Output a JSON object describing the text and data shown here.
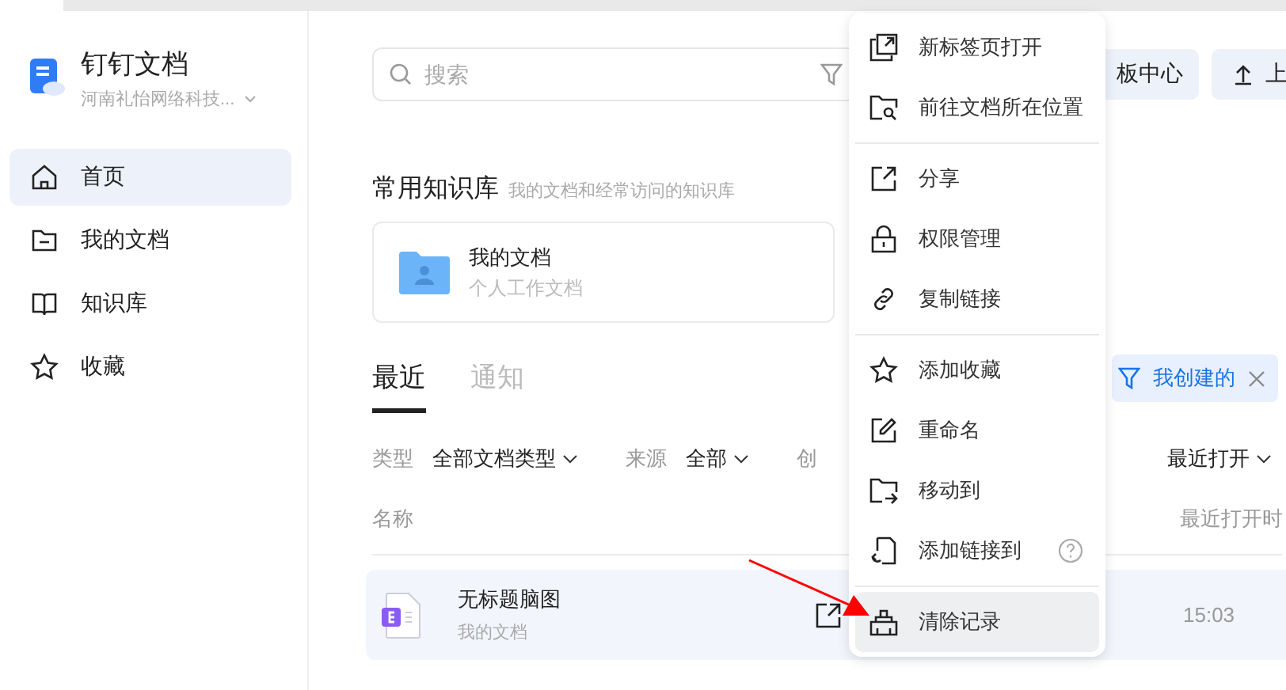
{
  "sidebar": {
    "app_title": "钉钉文档",
    "organization": "河南礼怡网络科技...",
    "items": [
      {
        "label": "首页",
        "selected": true
      },
      {
        "label": "我的文档",
        "selected": false
      },
      {
        "label": "知识库",
        "selected": false
      },
      {
        "label": "收藏",
        "selected": false
      }
    ]
  },
  "search": {
    "placeholder": "搜索"
  },
  "header_buttons": [
    "板中心",
    "上"
  ],
  "knowledge": {
    "title": "常用知识库",
    "subtitle": "我的文档和经常访问的知识库",
    "card": {
      "name": "我的文档",
      "description": "个人工作文档"
    }
  },
  "tabs": [
    {
      "label": "最近",
      "selected": true
    },
    {
      "label": "通知",
      "selected": false
    }
  ],
  "filter_chip": {
    "label": "我创建的"
  },
  "filters": [
    {
      "label": "类型",
      "value": "全部文档类型"
    },
    {
      "label": "来源",
      "value": "全部"
    },
    {
      "label": "创"
    }
  ],
  "sort": {
    "value": "最近打开"
  },
  "table": {
    "columns": [
      "名称",
      "最近打开时"
    ],
    "rows": [
      {
        "title": "无标题脑图",
        "location": "我的文档",
        "time": "15:03"
      }
    ]
  },
  "menu": {
    "groups": [
      [
        {
          "label": "新标签页打开",
          "selected": false,
          "help": false
        },
        {
          "label": "前往文档所在位置",
          "selected": false,
          "help": false
        }
      ],
      [
        {
          "label": "分享",
          "selected": false,
          "help": false
        },
        {
          "label": "权限管理",
          "selected": false,
          "help": false
        },
        {
          "label": "复制链接",
          "selected": false,
          "help": false
        }
      ],
      [
        {
          "label": "添加收藏",
          "selected": false,
          "help": false
        },
        {
          "label": "重命名",
          "selected": false,
          "help": false
        },
        {
          "label": "移动到",
          "selected": false,
          "help": false
        },
        {
          "label": "添加链接到",
          "selected": false,
          "help": true
        }
      ],
      [
        {
          "label": "清除记录",
          "selected": true,
          "help": false
        }
      ]
    ]
  }
}
